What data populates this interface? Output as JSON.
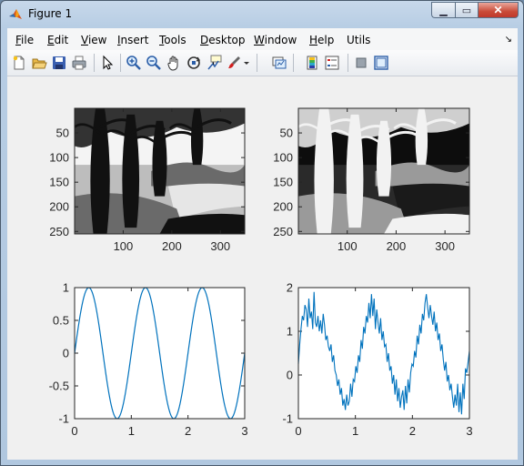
{
  "window": {
    "title": "Figure 1"
  },
  "menu": [
    {
      "label": "File",
      "key": "F",
      "rest": "ile"
    },
    {
      "label": "Edit",
      "key": "E",
      "rest": "dit"
    },
    {
      "label": "View",
      "key": "V",
      "rest": "iew"
    },
    {
      "label": "Insert",
      "key": "I",
      "rest": "nsert"
    },
    {
      "label": "Tools",
      "key": "T",
      "rest": "ools"
    },
    {
      "label": "Desktop",
      "key": "D",
      "rest": "esktop"
    },
    {
      "label": "Window",
      "key": "W",
      "rest": "indow"
    },
    {
      "label": "Help",
      "key": "H",
      "rest": "elp"
    },
    {
      "label": "Utils",
      "key": "",
      "rest": "Utils"
    }
  ],
  "toolbar_icons": [
    "new-figure-icon",
    "open-file-icon",
    "save-icon",
    "print-icon",
    "edit-plot-arrow-icon",
    "zoom-in-icon",
    "zoom-out-icon",
    "pan-hand-icon",
    "rotate-3d-icon",
    "data-cursor-icon",
    "brush-icon",
    "brush-dropdown-icon",
    "link-plot-icon",
    "colorbar-icon",
    "legend-icon",
    "hide-plot-tools-icon",
    "show-plot-tools-icon"
  ],
  "colors": {
    "line": "#0072bd",
    "axes_bg": "#ffffff",
    "figure_bg": "#f0f0f0"
  },
  "chart_data": [
    {
      "type": "image",
      "image": "grayscale painting of trees by a river",
      "x_ticks": [
        100,
        200,
        300
      ],
      "y_ticks": [
        50,
        100,
        150,
        200,
        250
      ],
      "xlim": [
        0,
        350
      ],
      "ylim": [
        0,
        255
      ],
      "y_reversed": true
    },
    {
      "type": "image",
      "image": "inverted high-contrast grayscale painting of trees by a river",
      "x_ticks": [
        100,
        200,
        300
      ],
      "y_ticks": [
        50,
        100,
        150,
        200,
        250
      ],
      "xlim": [
        0,
        350
      ],
      "ylim": [
        0,
        255
      ],
      "y_reversed": true
    },
    {
      "type": "line",
      "function": "sin(2*pi*x)",
      "xlim": [
        0,
        3
      ],
      "ylim": [
        -1,
        1
      ],
      "x_ticks": [
        0,
        1,
        2,
        3
      ],
      "y_ticks": [
        -1,
        -0.5,
        0,
        0.5,
        1
      ],
      "series": [
        {
          "x_range": [
            0,
            3
          ],
          "shape": "sine",
          "amplitude": 1,
          "period": 1
        }
      ]
    },
    {
      "type": "line",
      "function": "sin(2*pi*x) + noise",
      "xlim": [
        0,
        3
      ],
      "ylim": [
        -1,
        2
      ],
      "x_ticks": [
        0,
        1,
        2,
        3
      ],
      "y_ticks": [
        -1,
        0,
        1,
        2
      ],
      "series": [
        {
          "x_range": [
            0,
            3
          ],
          "y": [
            0.25,
            0.7,
            1.05,
            1.35,
            1.25,
            1.6,
            1.5,
            1.1,
            1.75,
            1.3,
            1.45,
            1.05,
            1.9,
            1.2,
            1.1,
            1.35,
            1.0,
            1.25,
            0.95,
            1.4,
            1.15,
            0.8,
            0.9,
            0.65,
            0.55,
            0.7,
            0.3,
            0.45,
            0.1,
            0.0,
            -0.25,
            -0.1,
            -0.45,
            -0.3,
            -0.7,
            -0.55,
            -0.8,
            -0.45,
            -0.7,
            -0.6,
            -0.2,
            -0.5,
            -0.1,
            -0.15,
            0.2,
            0.05,
            0.45,
            0.3,
            0.8,
            0.6,
            1.1,
            0.95,
            1.35,
            1.2,
            1.65,
            1.3,
            1.85,
            1.35,
            1.75,
            1.05,
            1.5,
            1.2,
            0.95,
            1.3,
            0.8,
            1.0,
            0.65,
            0.7,
            0.3,
            0.5,
            0.1,
            0.2,
            -0.2,
            0.0,
            -0.45,
            -0.1,
            -0.6,
            -0.3,
            -0.75,
            -0.5,
            -0.35,
            -0.8,
            -0.25,
            -0.65,
            -0.1,
            -0.4,
            0.05,
            0.25,
            0.2,
            0.55,
            0.4,
            0.9,
            0.7,
            1.15,
            0.95,
            1.4,
            1.25,
            1.65,
            1.85,
            1.55,
            1.3,
            1.6,
            1.35,
            1.15,
            1.45,
            1.0,
            1.2,
            0.8,
            0.95,
            0.55,
            0.7,
            0.35,
            0.1,
            0.3,
            -0.15,
            0.0,
            -0.35,
            -0.2,
            -0.5,
            -0.75,
            -0.45,
            -0.7,
            -0.2,
            -0.85,
            -0.4,
            -0.9,
            -0.2,
            -0.55,
            0.15,
            0.05,
            0.3,
            0.55
          ]
        }
      ]
    }
  ]
}
